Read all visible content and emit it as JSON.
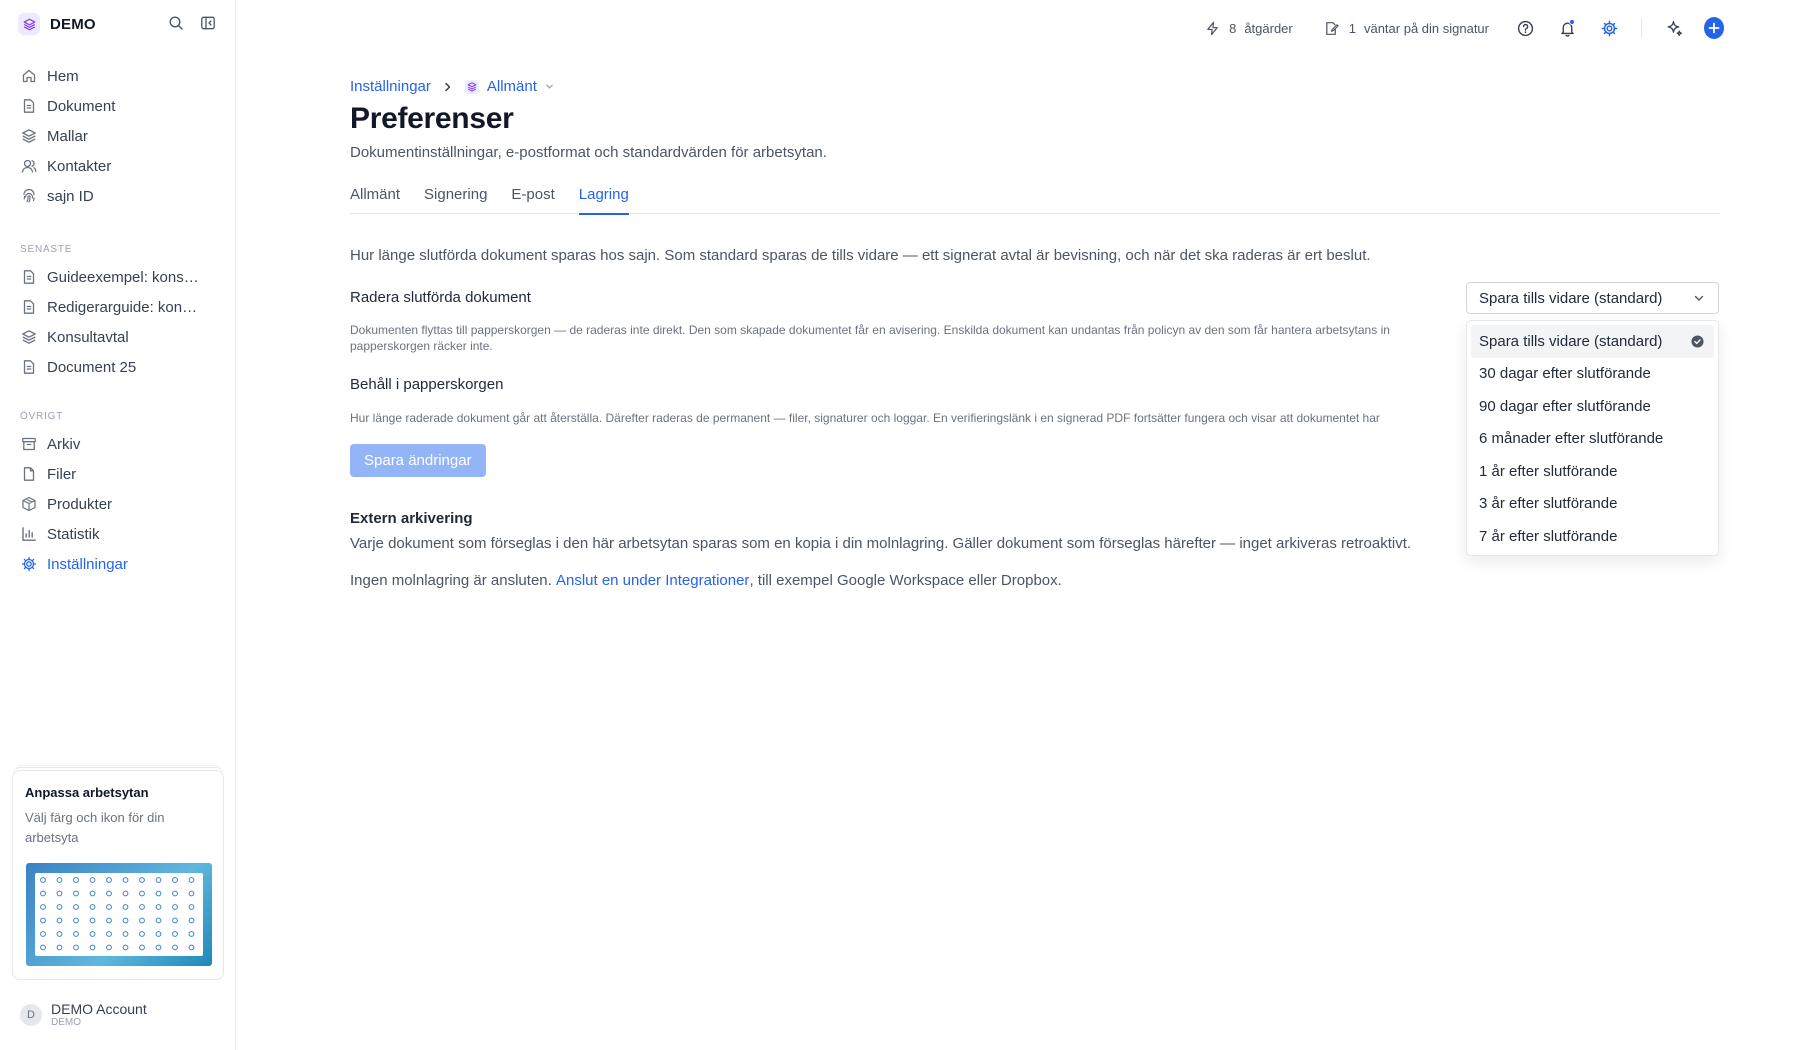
{
  "workspace": {
    "name": "DEMO"
  },
  "sidebar": {
    "nav": [
      {
        "label": "Hem",
        "icon": "home-icon"
      },
      {
        "label": "Dokument",
        "icon": "document-icon"
      },
      {
        "label": "Mallar",
        "icon": "layers-icon"
      },
      {
        "label": "Kontakter",
        "icon": "contacts-icon"
      },
      {
        "label": "sajn ID",
        "icon": "fingerprint-icon"
      }
    ],
    "recent_title": "SENASTE",
    "recent": [
      {
        "label": "Guideexempel: kons…",
        "icon": "document-icon"
      },
      {
        "label": "Redigerarguide: kon…",
        "icon": "document-icon"
      },
      {
        "label": "Konsultavtal",
        "icon": "layers-icon"
      },
      {
        "label": "Document 25",
        "icon": "document-icon"
      }
    ],
    "other_title": "ÖVRIGT",
    "other": [
      {
        "label": "Arkiv",
        "icon": "archive-icon"
      },
      {
        "label": "Filer",
        "icon": "file-icon"
      },
      {
        "label": "Produkter",
        "icon": "box-icon"
      },
      {
        "label": "Statistik",
        "icon": "chart-icon"
      },
      {
        "label": "Inställningar",
        "icon": "gear-icon",
        "active": true
      }
    ],
    "promo": {
      "title": "Anpassa arbetsytan",
      "text": "Välj färg och ikon för din arbetsyta"
    },
    "account": {
      "initial": "D",
      "name": "DEMO Account",
      "workspace": "DEMO"
    }
  },
  "topbar": {
    "actions_count": "8",
    "actions_label": "åtgärder",
    "signature_count": "1",
    "signature_label": "väntar på din signatur"
  },
  "page": {
    "breadcrumb_root": "Inställningar",
    "breadcrumb_current": "Allmänt",
    "title": "Preferenser",
    "subtitle": "Dokumentinställningar, e-postformat och standardvärden för arbetsytan.",
    "tabs": [
      "Allmänt",
      "Signering",
      "E-post",
      "Lagring"
    ],
    "active_tab": "Lagring",
    "intro": "Hur länge slutförda dokument sparas hos sajn. Som standard sparas de tills vidare — ett signerat avtal är bevisning, och när det ska raderas är ert beslut.",
    "delete_label": "Radera slutförda dokument",
    "delete_hint": "Dokumenten flyttas till papperskorgen — de raderas inte direkt. Den som skapade dokumentet får en avisering. Enskilda dokument kan undantas från policyn av den som får hantera arbetsytans in",
    "delete_hint_2": "papperskorgen räcker inte.",
    "trash_label": "Behåll i papperskorgen",
    "trash_hint": "Hur länge raderade dokument går att återställa. Därefter raderas de permanent — filer, signaturer och loggar. En verifieringslänk i en signerad PDF fortsätter fungera och visar att dokumentet har",
    "save_button": "Spara ändringar",
    "ext_title": "Extern arkivering",
    "ext_text": "Varje dokument som förseglas i den här arbetsytan sparas som en kopia i din molnlagring. Gäller dokument som förseglas härefter — inget arkiveras retroaktivt.",
    "ext_cloud_prefix": "Ingen molnlagring är ansluten. ",
    "ext_cloud_link": "Anslut en under Integrationer",
    "ext_cloud_suffix": ", till exempel Google Workspace eller Dropbox."
  },
  "retention_select": {
    "value": "Spara tills vidare (standard)",
    "options": [
      "Spara tills vidare (standard)",
      "30 dagar efter slutförande",
      "90 dagar efter slutförande",
      "6 månader efter slutförande",
      "1 år efter slutförande",
      "3 år efter slutförande",
      "7 år efter slutförande"
    ]
  },
  "colors": {
    "accent": "#2563eb",
    "button_disabled": "#93b4f6"
  }
}
